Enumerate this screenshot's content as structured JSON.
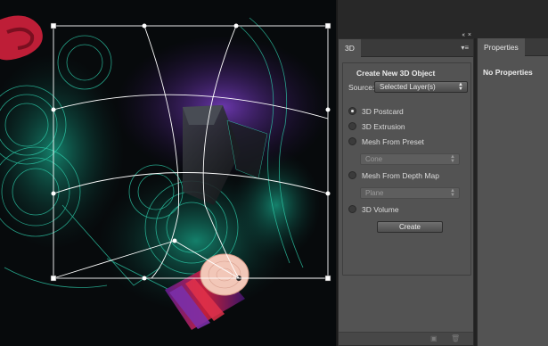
{
  "panel3d": {
    "collapse_glyph": "‹‹",
    "close_glyph": "×",
    "tab_label": "3D",
    "menu_icon": "panel-menu-icon",
    "title": "Create New 3D Object",
    "source_label": "Source:",
    "source_value": "Selected Layer(s)",
    "options": [
      {
        "label": "3D Postcard",
        "selected": true
      },
      {
        "label": "3D Extrusion",
        "selected": false
      },
      {
        "label": "Mesh From Preset",
        "selected": false
      },
      {
        "label": "Mesh From Depth Map",
        "selected": false
      },
      {
        "label": "3D Volume",
        "selected": false
      }
    ],
    "preset_value": "Cone",
    "depth_map_value": "Plane",
    "create_label": "Create",
    "footer_icons": [
      "new-layer-icon",
      "trash-icon"
    ]
  },
  "properties": {
    "tab_label": "Properties",
    "message": "No Properties"
  },
  "colors": {
    "panel_bg": "#535353",
    "canvas_bg": "#070a0c",
    "art_teal": "#2fd3b0",
    "art_red": "#d4223a",
    "art_purple": "#6a2a8a"
  }
}
